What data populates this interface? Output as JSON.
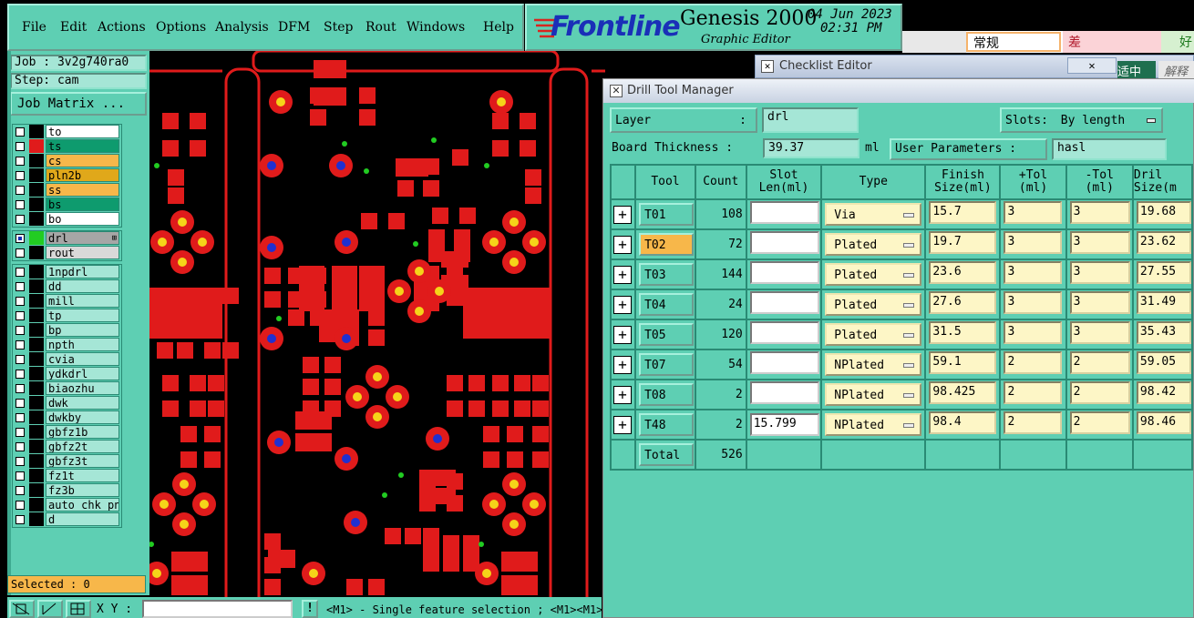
{
  "menu": {
    "items": [
      "File",
      "Edit",
      "Actions",
      "Options",
      "Analysis",
      "DFM",
      "Step",
      "Rout",
      "Windows",
      "Help"
    ]
  },
  "logo": {
    "brand": "Frontline",
    "product": "Genesis 2000",
    "subtitle": "Graphic Editor",
    "date": "04 Jun 2023",
    "time": "02:31 PM"
  },
  "background_window": {
    "cells": [
      "常规",
      "差",
      "好"
    ],
    "labels": [
      "适中",
      "解释"
    ]
  },
  "sidebar": {
    "job": "Job : 3v2g740ra0",
    "step": "Step: cam",
    "job_matrix": "Job Matrix ...",
    "board_layers": [
      {
        "name": "to",
        "color": "#ffffff"
      },
      {
        "name": "ts",
        "color": "#0e9b6e",
        "active": true
      },
      {
        "name": "cs",
        "color": "#f7b74a"
      },
      {
        "name": "pln2b",
        "color": "#e0a81a"
      },
      {
        "name": "ss",
        "color": "#f7b74a"
      },
      {
        "name": "bs",
        "color": "#0e9b6e"
      },
      {
        "name": "bo",
        "color": "#ffffff"
      }
    ],
    "drill_layers": [
      {
        "name": "drl",
        "color": "#22cc22",
        "selected": true,
        "mark": "⊞"
      },
      {
        "name": "rout",
        "color": "#d9d9d9"
      }
    ],
    "misc_layers": [
      "1npdrl",
      "dd",
      "mill",
      "tp",
      "bp",
      "npth",
      "cvia",
      "ydkdrl",
      "biaozhu",
      "dwk",
      "dwkby",
      "gbfz1b",
      "gbfz2t",
      "gbfz3t",
      "fz1t",
      "fz3b",
      "auto_chk_pni",
      "d"
    ],
    "selected": "Selected : 0"
  },
  "bottombar": {
    "xy_label": "X Y :",
    "status": "<M1> - Single feature selection ; <M1><M1>"
  },
  "checklist": {
    "title": "Checklist Editor"
  },
  "dtm": {
    "title": "Drill Tool Manager",
    "layer_label": "Layer",
    "layer_value": "drl",
    "slots_label": "Slots:",
    "slots_value": "By length",
    "thickness_label": "Board Thickness :",
    "thickness_value": "39.37",
    "thickness_unit": "ml",
    "user_params_label": "User Parameters :",
    "user_params_value": "hasl",
    "headers": [
      "Tool",
      "Count",
      "Slot\nLen(ml)",
      "Type",
      "Finish\nSize(ml)",
      "+Tol\n(ml)",
      "-Tol\n(ml)",
      "Dril\nSize(m"
    ],
    "rows": [
      {
        "tool": "T01",
        "count": "108",
        "slot": "",
        "type": "Via",
        "finish": "15.7",
        "ptol": "3",
        "mtol": "3",
        "drill": "19.68"
      },
      {
        "tool": "T02",
        "count": "72",
        "slot": "",
        "type": "Plated",
        "finish": "19.7",
        "ptol": "3",
        "mtol": "3",
        "drill": "23.62",
        "selected": true
      },
      {
        "tool": "T03",
        "count": "144",
        "slot": "",
        "type": "Plated",
        "finish": "23.6",
        "ptol": "3",
        "mtol": "3",
        "drill": "27.55"
      },
      {
        "tool": "T04",
        "count": "24",
        "slot": "",
        "type": "Plated",
        "finish": "27.6",
        "ptol": "3",
        "mtol": "3",
        "drill": "31.49"
      },
      {
        "tool": "T05",
        "count": "120",
        "slot": "",
        "type": "Plated",
        "finish": "31.5",
        "ptol": "3",
        "mtol": "3",
        "drill": "35.43"
      },
      {
        "tool": "T07",
        "count": "54",
        "slot": "",
        "type": "NPlated",
        "finish": "59.1",
        "ptol": "2",
        "mtol": "2",
        "drill": "59.05"
      },
      {
        "tool": "T08",
        "count": "2",
        "slot": "",
        "type": "NPlated",
        "finish": "98.425",
        "ptol": "2",
        "mtol": "2",
        "drill": "98.42"
      },
      {
        "tool": "T48",
        "count": "2",
        "slot": "15.799",
        "type": "NPlated",
        "finish": "98.4",
        "ptol": "2",
        "mtol": "2",
        "drill": "98.46"
      }
    ],
    "total_label": "Total",
    "total_count": "526"
  }
}
